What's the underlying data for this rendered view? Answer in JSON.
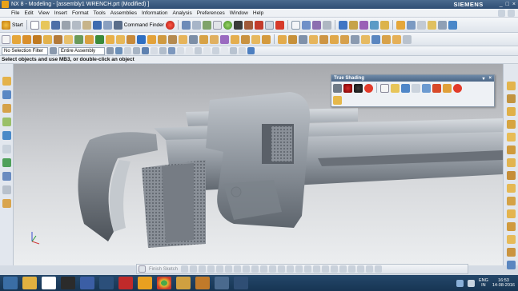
{
  "window": {
    "title": "NX 8 - Modeling - [assembly1 WRENCH.prt (Modified) ]",
    "brand": "SIEMENS",
    "controls": [
      "_",
      "□",
      "×"
    ]
  },
  "menu": {
    "items": [
      "File",
      "Edit",
      "View",
      "Insert",
      "Format",
      "Tools",
      "Assemblies",
      "Information",
      "Analysis",
      "Preferences",
      "Window",
      "Help"
    ]
  },
  "toolbar": {
    "start_label": "Start",
    "command_finder_label": "Command Finder"
  },
  "selection": {
    "filter_value": "No Selection Filter",
    "scope_value": "Entire Assembly"
  },
  "cue_line": "Select objects and use MB3, or double-click an object",
  "true_shading": {
    "title": "True Shading"
  },
  "bottom_toolbar": {
    "finish_sketch_label": "Finish Sketch"
  },
  "taskbar": {
    "lang_line1": "ENG",
    "lang_line2": "IN",
    "time": "16:53",
    "date": "14-08-2016"
  },
  "colors": {
    "title_bar": "#2f4e74",
    "taskbar": "#1b3a5a",
    "viewport_top": "#a7a9ad",
    "viewport_bottom": "#eceef0",
    "wrench_metal": "#8f969e"
  }
}
